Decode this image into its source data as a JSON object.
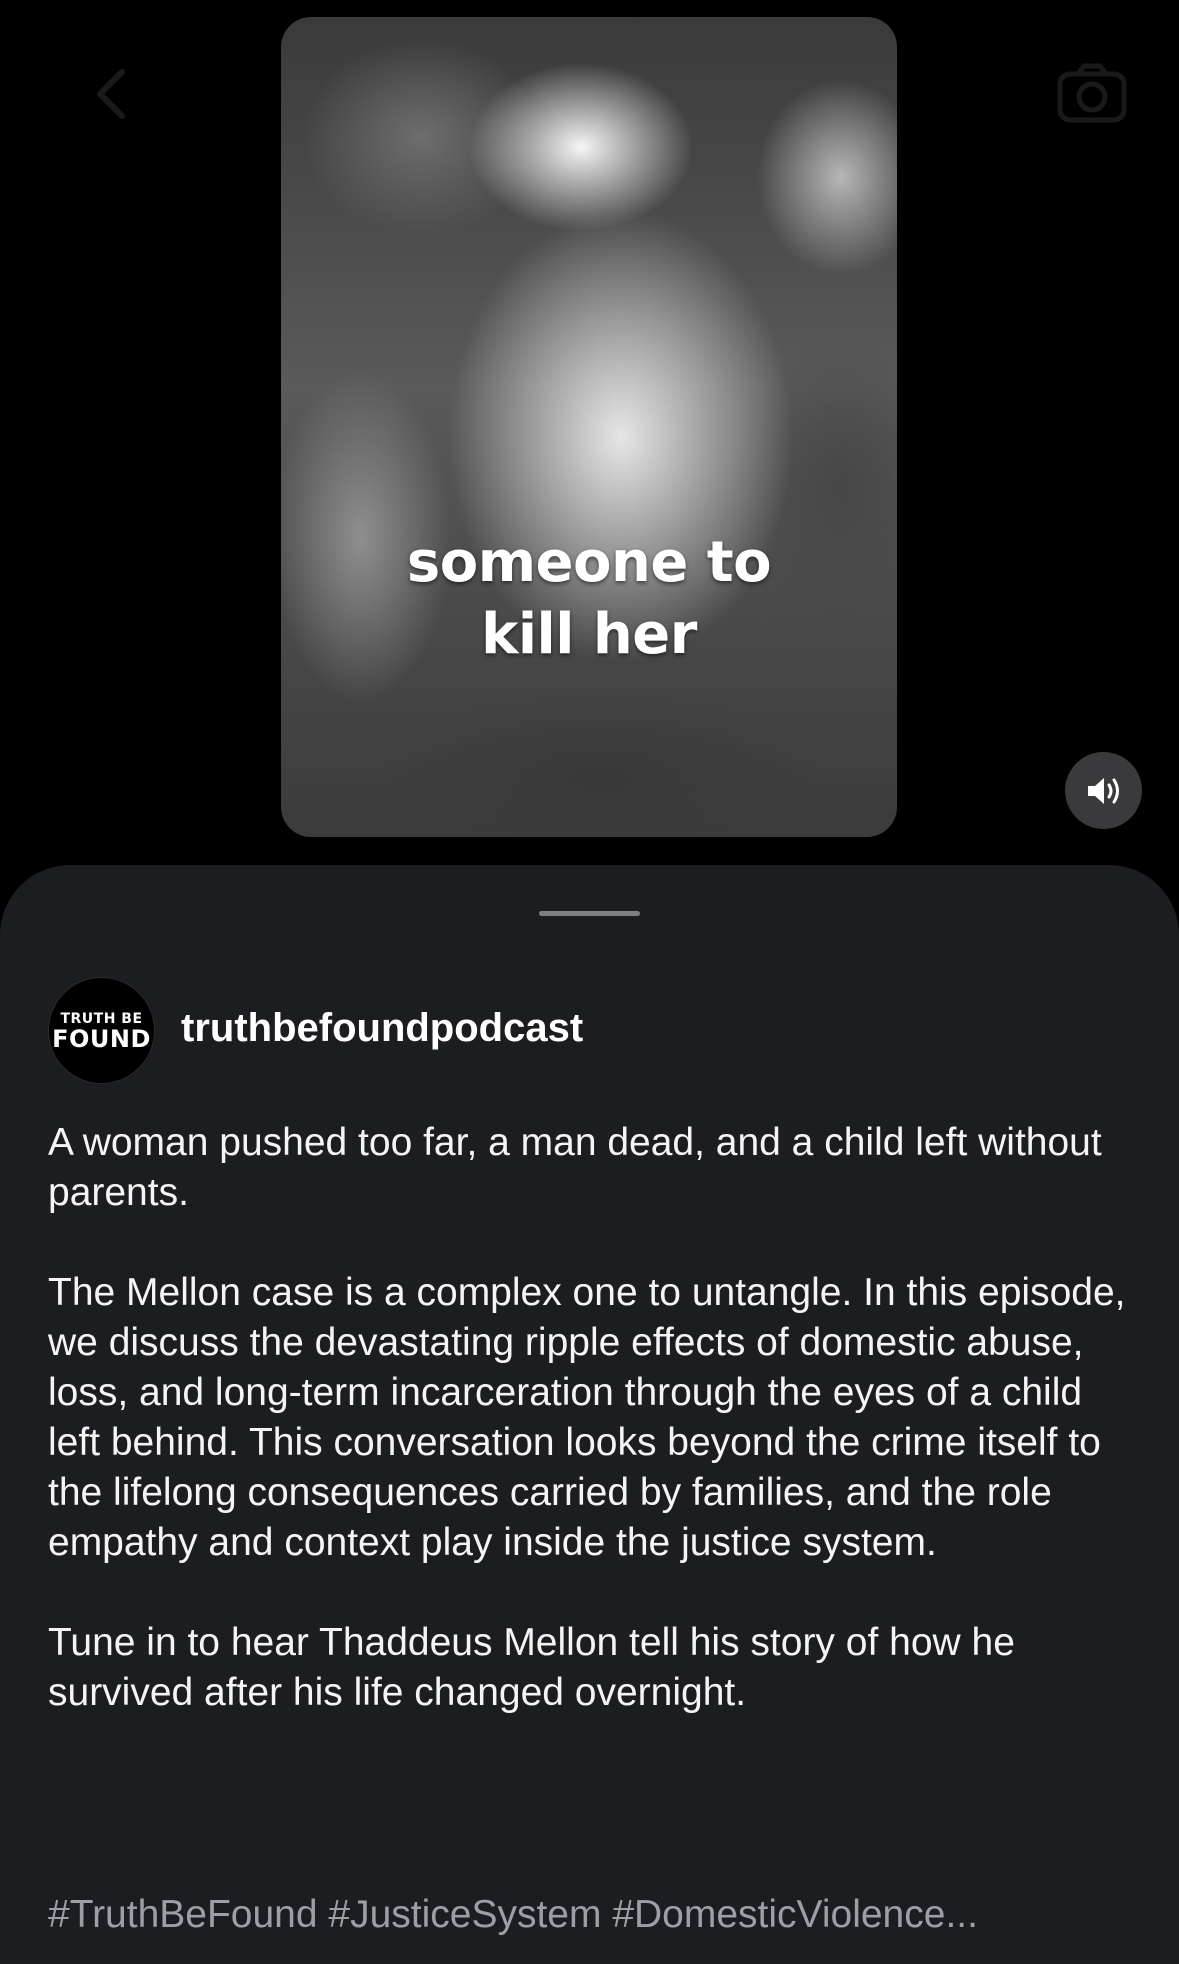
{
  "header": {
    "back_icon": "chevron-left-icon",
    "camera_icon": "camera-icon"
  },
  "video": {
    "caption_line1": "someone to",
    "caption_line2": "kill her",
    "volume_icon": "speaker-on-icon"
  },
  "post": {
    "avatar": {
      "line1": "TRUTH BE",
      "line2": "FOUND"
    },
    "username": "truthbefoundpodcast",
    "paragraphs": [
      "A woman pushed too far, a man dead, and a child left without parents.",
      "The Mellon case is a complex one to untangle. In this episode, we discuss the devastating ripple effects of domestic abuse, loss, and long-term incarceration through the eyes of a child left behind. This conversation looks beyond the crime itself to the lifelong consequences carried by families, and the role empathy and context play inside the justice system.",
      "Tune in to hear Thaddeus Mellon tell his story of how he survived after his life changed overnight."
    ],
    "hashtags": "#TruthBeFound #JusticeSystem #DomesticViolence..."
  },
  "colors": {
    "background": "#000000",
    "sheet": "#1c1d21",
    "hashtag": "#9c9fa6",
    "volume_button": "#3a3a3c"
  }
}
